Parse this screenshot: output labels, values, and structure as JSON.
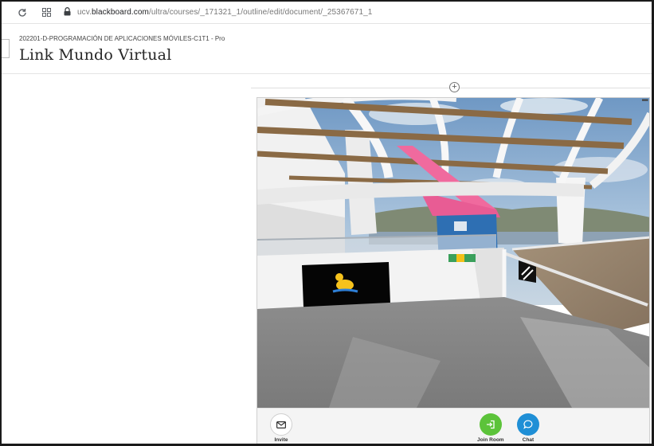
{
  "browser": {
    "url_prefix": "ucv.",
    "url_domain": "blackboard.com",
    "url_path": "/ultra/courses/_171321_1/outline/edit/document/_25367671_1"
  },
  "header": {
    "course": "202201-D-PROGRAMACIÓN DE APLICACIONES MÓVILES-C1T1 - Pro",
    "title": "Link Mundo Virtual"
  },
  "content": {
    "add_symbol": "+",
    "more_symbol": "•••"
  },
  "toolbar": {
    "invite_label": "Invite",
    "join_label": "Join Room",
    "chat_label": "Chat"
  },
  "colors": {
    "join": "#5cc33a",
    "chat": "#1f8fd6",
    "pink_banner": "#f06a9e",
    "sky": "#8fb3d6"
  },
  "icons": [
    "reload-icon",
    "apps-icon",
    "lock-icon",
    "add-content-icon",
    "more-options-icon",
    "mail-icon",
    "join-room-icon",
    "chat-icon"
  ]
}
